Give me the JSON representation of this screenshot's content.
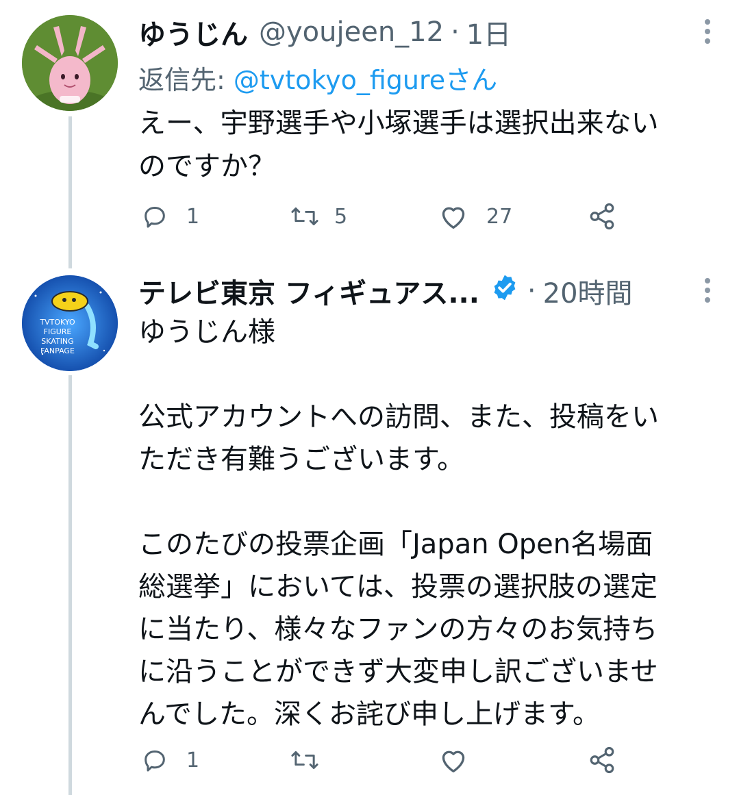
{
  "tweets": [
    {
      "name": "ゆうじん",
      "handle": "@youjeen_12",
      "dot": "·",
      "time": "1日",
      "reply_prefix": "返信先: ",
      "reply_mention": "@tvtokyo_figure",
      "reply_suffix": "さん",
      "lines": [
        "えー、宇野選手や小塚選手は選択出来ない",
        "のですか？"
      ],
      "replies": "1",
      "retweets": "5",
      "likes": "27"
    },
    {
      "name": "テレビ東京 フィギュアス...",
      "verified": true,
      "dot": "·",
      "time": "20時間",
      "avatar_text": [
        "TVTOKYO",
        "FIGURE",
        "SKATING",
        "FANPAGE"
      ],
      "lines": [
        "ゆうじん様",
        "",
        "公式アカウントへの訪問、また、投稿をい",
        "ただき有難うございます。",
        "",
        "このたびの投票企画「Japan Open名場面",
        "総選挙」においては、投票の選択肢の選定",
        "に当たり、様々なファンの方々のお気持ち",
        "に沿うことができず大変申し訳ございませ",
        "んでした。深くお詫び申し上げます。"
      ],
      "replies": "1",
      "retweets": "",
      "likes": ""
    }
  ],
  "icons": {
    "reply": "reply-icon",
    "retweet": "retweet-icon",
    "like": "heart-icon",
    "share": "share-icon",
    "more": "more-icon",
    "verified": "verified-badge-icon"
  },
  "colors": {
    "link": "#1d9bf0",
    "secondary": "#536471",
    "verified": "#1d9bf0",
    "thread_line": "#cfd9de"
  }
}
